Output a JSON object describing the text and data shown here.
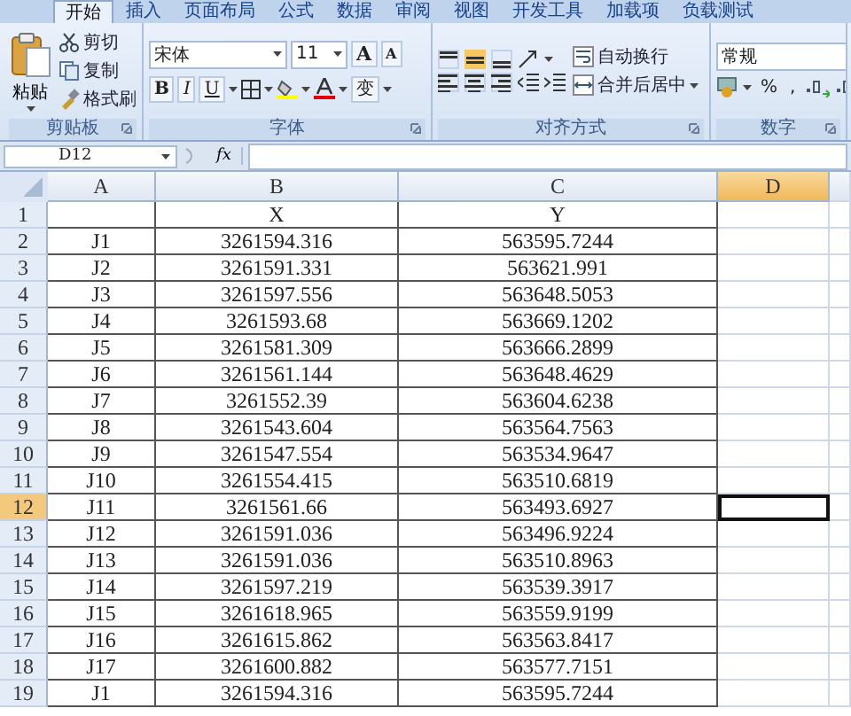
{
  "tabs": [
    {
      "label": "开始",
      "selected": true
    },
    {
      "label": "插入",
      "selected": false
    },
    {
      "label": "页面布局",
      "selected": false
    },
    {
      "label": "公式",
      "selected": false
    },
    {
      "label": "数据",
      "selected": false
    },
    {
      "label": "审阅",
      "selected": false
    },
    {
      "label": "视图",
      "selected": false
    },
    {
      "label": "开发工具",
      "selected": false
    },
    {
      "label": "加载项",
      "selected": false
    },
    {
      "label": "负载测试",
      "selected": false
    }
  ],
  "ribbon": {
    "clipboard": {
      "paste": "粘贴",
      "cut": "剪切",
      "copy": "复制",
      "format_painter": "格式刷",
      "label": "剪贴板"
    },
    "font": {
      "font_name": "宋体",
      "font_size": "11",
      "grow": "A",
      "shrink": "A",
      "bold": "B",
      "italic": "I",
      "underline": "U",
      "phonetic": "变",
      "label": "字体"
    },
    "alignment": {
      "wrap_text": "自动换行",
      "merge_center": "合并后居中",
      "label": "对齐方式"
    },
    "number": {
      "format": "常规",
      "percent": "%",
      "comma": ",",
      "label": "数字"
    }
  },
  "formula_bar": {
    "name_box": "D12",
    "fx": "fx"
  },
  "sheet": {
    "columns": [
      {
        "label": "A",
        "selected": false
      },
      {
        "label": "B",
        "selected": false
      },
      {
        "label": "C",
        "selected": false
      },
      {
        "label": "D",
        "selected": true
      }
    ],
    "rows": [
      {
        "number": "1",
        "selected": false,
        "b": "X",
        "c": "Y"
      },
      {
        "number": "2",
        "selected": false,
        "a": "J1",
        "b": "3261594.316",
        "c": "563595.7244"
      },
      {
        "number": "3",
        "selected": false,
        "a": "J2",
        "b": "3261591.331",
        "c": "563621.991"
      },
      {
        "number": "4",
        "selected": false,
        "a": "J3",
        "b": "3261597.556",
        "c": "563648.5053"
      },
      {
        "number": "5",
        "selected": false,
        "a": "J4",
        "b": "3261593.68",
        "c": "563669.1202"
      },
      {
        "number": "6",
        "selected": false,
        "a": "J5",
        "b": "3261581.309",
        "c": "563666.2899"
      },
      {
        "number": "7",
        "selected": false,
        "a": "J6",
        "b": "3261561.144",
        "c": "563648.4629"
      },
      {
        "number": "8",
        "selected": false,
        "a": "J7",
        "b": "3261552.39",
        "c": "563604.6238"
      },
      {
        "number": "9",
        "selected": false,
        "a": "J8",
        "b": "3261543.604",
        "c": "563564.7563"
      },
      {
        "number": "10",
        "selected": false,
        "a": "J9",
        "b": "3261547.554",
        "c": "563534.9647"
      },
      {
        "number": "11",
        "selected": false,
        "a": "J10",
        "b": "3261554.415",
        "c": "563510.6819"
      },
      {
        "number": "12",
        "selected": true,
        "a": "J11",
        "b": "3261561.66",
        "c": "563493.6927"
      },
      {
        "number": "13",
        "selected": false,
        "a": "J12",
        "b": "3261591.036",
        "c": "563496.9224"
      },
      {
        "number": "14",
        "selected": false,
        "a": "J13",
        "b": "3261591.036",
        "c": "563510.8963"
      },
      {
        "number": "15",
        "selected": false,
        "a": "J14",
        "b": "3261597.219",
        "c": "563539.3917"
      },
      {
        "number": "16",
        "selected": false,
        "a": "J15",
        "b": "3261618.965",
        "c": "563559.9199"
      },
      {
        "number": "17",
        "selected": false,
        "a": "J16",
        "b": "3261615.862",
        "c": "563563.8417"
      },
      {
        "number": "18",
        "selected": false,
        "a": "J17",
        "b": "3261600.882",
        "c": "563577.7151"
      },
      {
        "number": "19",
        "selected": false,
        "a": "J1",
        "b": "3261594.316",
        "c": "563595.7244"
      }
    ]
  }
}
